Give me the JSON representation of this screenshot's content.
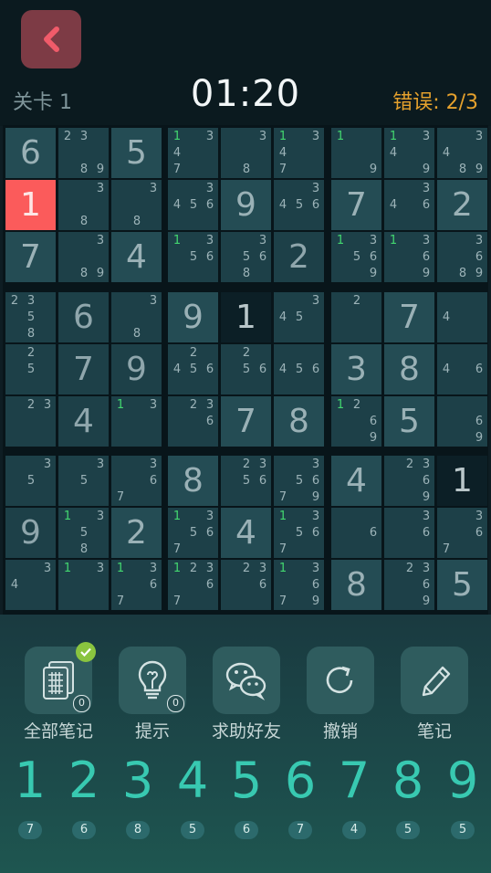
{
  "header": {
    "back_icon": "chevron-left-icon",
    "level": "关卡 1",
    "timer": "01:20",
    "mistakes_label": "错误: 2/3"
  },
  "board": {
    "selected": [
      1,
      0
    ],
    "rows": [
      [
        {
          "v": "6",
          "g": 1
        },
        {
          "c": [
            "2",
            "3",
            "",
            "",
            "",
            "",
            "",
            "8",
            "9"
          ]
        },
        {
          "v": "5",
          "g": 1
        },
        {
          "c": [
            "1",
            "",
            "3",
            "4",
            "",
            "",
            "7",
            "",
            ""
          ],
          "gr": [
            0
          ]
        },
        {
          "c": [
            "",
            "",
            "3",
            "",
            "",
            "",
            "",
            "8",
            ""
          ]
        },
        {
          "c": [
            "1",
            "",
            "3",
            "4",
            "",
            "",
            "7",
            "",
            ""
          ],
          "gr": [
            0
          ]
        },
        {
          "c": [
            "1",
            "",
            "",
            "",
            "",
            "",
            "",
            "",
            "9"
          ],
          "gr": [
            0
          ]
        },
        {
          "c": [
            "1",
            "",
            "3",
            "4",
            "",
            "",
            "",
            "",
            "9"
          ],
          "gr": [
            0
          ]
        },
        {
          "c": [
            "",
            "",
            "3",
            "4",
            "",
            "",
            "",
            "8",
            "9"
          ]
        }
      ],
      [
        {
          "v": "1",
          "sel": 1
        },
        {
          "c": [
            "",
            "",
            "3",
            "",
            "",
            "",
            "",
            "8",
            ""
          ]
        },
        {
          "c": [
            "",
            "",
            "3",
            "",
            "",
            "",
            "",
            "8",
            ""
          ]
        },
        {
          "c": [
            "",
            "",
            "3",
            "4",
            "5",
            "6",
            "",
            "",
            ""
          ]
        },
        {
          "v": "9",
          "g": 1
        },
        {
          "c": [
            "",
            "",
            "3",
            "4",
            "5",
            "6",
            "",
            "",
            ""
          ]
        },
        {
          "v": "7",
          "g": 1
        },
        {
          "c": [
            "",
            "",
            "3",
            "4",
            "",
            "6",
            "",
            "",
            ""
          ]
        },
        {
          "v": "2",
          "g": 1
        }
      ],
      [
        {
          "v": "7",
          "g": 1
        },
        {
          "c": [
            "",
            "",
            "3",
            "",
            "",
            "",
            "",
            "8",
            "9"
          ]
        },
        {
          "v": "4",
          "g": 1
        },
        {
          "c": [
            "1",
            "",
            "3",
            "",
            "5",
            "6",
            "",
            "",
            ""
          ],
          "gr": [
            0
          ]
        },
        {
          "c": [
            "",
            "",
            "3",
            "",
            "5",
            "6",
            "",
            "8",
            ""
          ]
        },
        {
          "v": "2",
          "g": 0
        },
        {
          "c": [
            "1",
            "",
            "3",
            "",
            "5",
            "6",
            "",
            "",
            "9"
          ],
          "gr": [
            0
          ]
        },
        {
          "c": [
            "1",
            "",
            "3",
            "",
            "",
            "6",
            "",
            "",
            "9"
          ],
          "gr": [
            0
          ]
        },
        {
          "c": [
            "",
            "",
            "3",
            "",
            "",
            "6",
            "",
            "8",
            "9"
          ]
        }
      ],
      [
        {
          "c": [
            "2",
            "3",
            "",
            "",
            "5",
            "",
            "",
            "8",
            ""
          ]
        },
        {
          "v": "6",
          "g": 0
        },
        {
          "c": [
            "",
            "",
            "3",
            "",
            "",
            "",
            "",
            "8",
            ""
          ]
        },
        {
          "v": "9",
          "g": 1
        },
        {
          "v": "1",
          "dark": 1
        },
        {
          "c": [
            "",
            "",
            "3",
            "4",
            "5",
            "",
            "",
            "",
            ""
          ]
        },
        {
          "c": [
            "",
            "2",
            "",
            "",
            "",
            "",
            "",
            "",
            ""
          ]
        },
        {
          "v": "7",
          "g": 1
        },
        {
          "c": [
            "",
            "",
            "",
            "4",
            "",
            "",
            "",
            "",
            ""
          ]
        }
      ],
      [
        {
          "c": [
            "",
            "2",
            "",
            "",
            "5",
            "",
            "",
            "",
            ""
          ]
        },
        {
          "v": "7",
          "g": 0
        },
        {
          "v": "9",
          "g": 0
        },
        {
          "c": [
            "",
            "2",
            "",
            "4",
            "5",
            "6",
            "",
            "",
            ""
          ]
        },
        {
          "c": [
            "",
            "2",
            "",
            "",
            "5",
            "6",
            "",
            "",
            ""
          ]
        },
        {
          "c": [
            "",
            "",
            "",
            "4",
            "5",
            "6",
            "",
            "",
            ""
          ]
        },
        {
          "v": "3",
          "g": 1
        },
        {
          "v": "8",
          "g": 1
        },
        {
          "c": [
            "",
            "",
            "",
            "4",
            "",
            "6",
            "",
            "",
            ""
          ]
        }
      ],
      [
        {
          "c": [
            "",
            "2",
            "3",
            "",
            "",
            "",
            "",
            "",
            ""
          ]
        },
        {
          "v": "4",
          "g": 0
        },
        {
          "c": [
            "1",
            "",
            "3",
            "",
            "",
            "",
            "",
            "",
            ""
          ],
          "gr": [
            0
          ]
        },
        {
          "c": [
            "",
            "2",
            "3",
            "",
            "",
            "6",
            "",
            "",
            ""
          ]
        },
        {
          "v": "7",
          "g": 1
        },
        {
          "v": "8",
          "g": 1
        },
        {
          "c": [
            "1",
            "2",
            "",
            "",
            "",
            "6",
            "",
            "",
            "9"
          ],
          "gr": [
            0
          ]
        },
        {
          "v": "5",
          "g": 1
        },
        {
          "c": [
            "",
            "",
            "",
            "",
            "",
            "6",
            "",
            "",
            "9"
          ]
        }
      ],
      [
        {
          "c": [
            "",
            "",
            "3",
            "",
            "5",
            "",
            "",
            "",
            ""
          ]
        },
        {
          "c": [
            "",
            "",
            "3",
            "",
            "5",
            "",
            "",
            "",
            ""
          ]
        },
        {
          "c": [
            "",
            "",
            "3",
            "",
            "",
            "6",
            "7",
            "",
            ""
          ]
        },
        {
          "v": "8",
          "g": 1
        },
        {
          "c": [
            "",
            "2",
            "3",
            "",
            "5",
            "6",
            "",
            "",
            ""
          ]
        },
        {
          "c": [
            "",
            "",
            "3",
            "",
            "5",
            "6",
            "7",
            "",
            "9"
          ]
        },
        {
          "v": "4",
          "g": 1
        },
        {
          "c": [
            "",
            "2",
            "3",
            "",
            "",
            "6",
            "",
            "",
            "9"
          ]
        },
        {
          "v": "1",
          "dark": 1
        }
      ],
      [
        {
          "v": "9",
          "g": 0
        },
        {
          "c": [
            "1",
            "",
            "3",
            "",
            "5",
            "",
            "",
            "8",
            ""
          ],
          "gr": [
            0
          ]
        },
        {
          "v": "2",
          "g": 1
        },
        {
          "c": [
            "1",
            "",
            "3",
            "",
            "5",
            "6",
            "7",
            "",
            ""
          ],
          "gr": [
            0
          ]
        },
        {
          "v": "4",
          "g": 1
        },
        {
          "c": [
            "1",
            "",
            "3",
            "",
            "5",
            "6",
            "7",
            "",
            ""
          ],
          "gr": [
            0
          ]
        },
        {
          "c": [
            "",
            "",
            "",
            "",
            "",
            "6",
            "",
            "",
            ""
          ]
        },
        {
          "c": [
            "",
            "",
            "3",
            "",
            "",
            "6",
            "",
            "",
            ""
          ]
        },
        {
          "c": [
            "",
            "",
            "3",
            "",
            "",
            "6",
            "7",
            "",
            ""
          ]
        }
      ],
      [
        {
          "c": [
            "",
            "",
            "3",
            "4",
            "",
            "",
            "",
            "",
            ""
          ]
        },
        {
          "c": [
            "1",
            "",
            "3",
            "",
            "",
            "",
            "",
            "",
            ""
          ],
          "gr": [
            0
          ]
        },
        {
          "c": [
            "1",
            "",
            "3",
            "",
            "",
            "6",
            "7",
            "",
            ""
          ],
          "gr": [
            0
          ]
        },
        {
          "c": [
            "1",
            "2",
            "3",
            "",
            "",
            "6",
            "7",
            "",
            ""
          ],
          "gr": [
            0
          ]
        },
        {
          "c": [
            "",
            "2",
            "3",
            "",
            "",
            "6",
            "",
            "",
            ""
          ]
        },
        {
          "c": [
            "1",
            "",
            "3",
            "",
            "",
            "6",
            "7",
            "",
            "9"
          ],
          "gr": [
            0
          ]
        },
        {
          "v": "8",
          "g": 1
        },
        {
          "c": [
            "",
            "2",
            "3",
            "",
            "",
            "6",
            "",
            "",
            "9"
          ]
        },
        {
          "v": "5",
          "g": 1
        }
      ]
    ]
  },
  "tools": [
    {
      "label": "全部笔记",
      "icon": "notes-grid-icon",
      "badge": "0",
      "checked": true
    },
    {
      "label": "提示",
      "icon": "lightbulb-icon",
      "badge": "0"
    },
    {
      "label": "求助好友",
      "icon": "wechat-icon"
    },
    {
      "label": "撤销",
      "icon": "undo-icon"
    },
    {
      "label": "笔记",
      "icon": "pencil-icon"
    }
  ],
  "numpad": [
    {
      "n": "1",
      "count": "7"
    },
    {
      "n": "2",
      "count": "6"
    },
    {
      "n": "3",
      "count": "8"
    },
    {
      "n": "4",
      "count": "5"
    },
    {
      "n": "5",
      "count": "6"
    },
    {
      "n": "6",
      "count": "7"
    },
    {
      "n": "7",
      "count": "4"
    },
    {
      "n": "8",
      "count": "5"
    },
    {
      "n": "9",
      "count": "5"
    }
  ],
  "colors": {
    "accent": "#38c9b1",
    "selected": "#fb5b5b",
    "mistakes": "#e5a12d",
    "candidate_green": "#43d66f"
  }
}
